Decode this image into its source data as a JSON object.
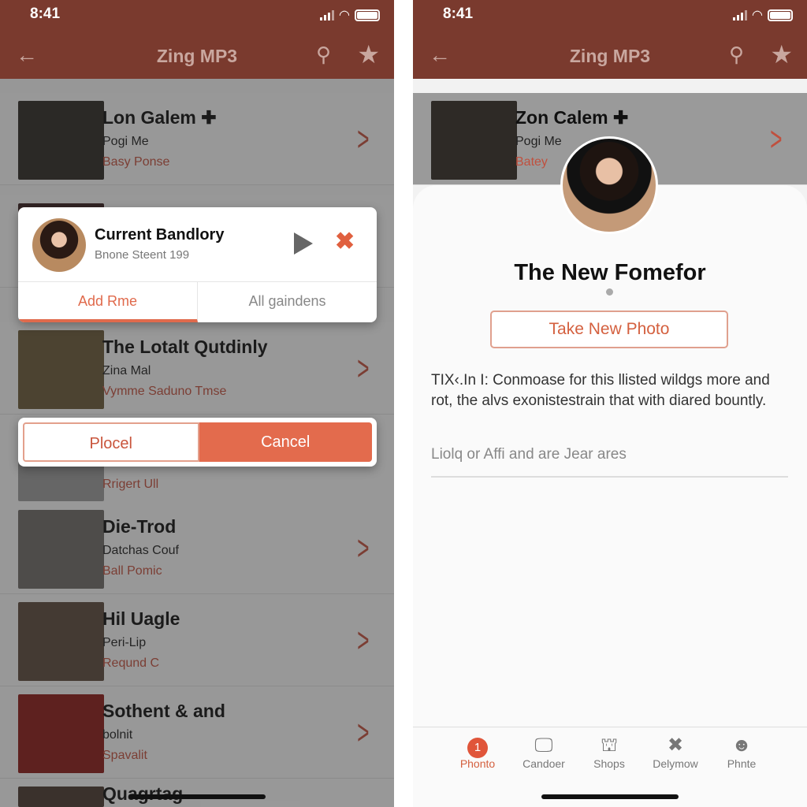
{
  "status": {
    "time": "8:41"
  },
  "app": {
    "title": "Zing MP3"
  },
  "left": {
    "rows": [
      {
        "title": "Lon Galem ✚",
        "subtitle": "Pogi Me",
        "artist": "Basy Ponse",
        "cover": "#2e2a26"
      },
      {
        "title": "",
        "subtitle": "",
        "artist": "",
        "cover": "#3a2020"
      },
      {
        "title": "The Lotalt Qutdinly",
        "subtitle": "Zina Mal",
        "artist": "Vymme Saduno Tmse",
        "cover": "#6a5a3a"
      },
      {
        "title": "",
        "subtitle": "",
        "artist": "Rrigert Ull",
        "cover": "#999"
      },
      {
        "title": "Die-Trod",
        "subtitle": "Datchas Couf",
        "artist": "Ball Pomic",
        "cover": "#6e6a66"
      },
      {
        "title": "Hil Uagle",
        "subtitle": "Peri-Lip",
        "artist": "Reqund C",
        "cover": "#5c4a3c"
      },
      {
        "title": "Sothent & and",
        "subtitle": "bolnit",
        "artist": "Spavalit",
        "cover": "#8a1c18"
      },
      {
        "title": "Quagrtag",
        "subtitle": "",
        "artist": "",
        "cover": "#4a3a30"
      }
    ],
    "modal": {
      "title": "Current Bandlory",
      "subtitle": "Bnone Steent 199",
      "tab_add": "Add Rme",
      "tab_all": "All gaindens"
    },
    "actions": {
      "primary": "Plocel",
      "cancel": "Cancel"
    }
  },
  "right": {
    "row": {
      "title": "Zon Calem ✚",
      "subtitle": "Pogi Me",
      "artist": "Batey",
      "cover": "#2e2a26"
    },
    "sheet": {
      "title": "The New Fomefor",
      "button": "Take New Photo",
      "paragraph": "TIX‹.In I: Conmoase for this llisted wildgs more and rot, the alvs exonistestrain that with diared bountly.",
      "field": "Liolq or Affi and are Jear ares"
    },
    "tabs": [
      {
        "label": "Phonto",
        "icon": "badge-1",
        "badge": "1",
        "active": true
      },
      {
        "label": "Candoer",
        "icon": "monitor-icon"
      },
      {
        "label": "Shops",
        "icon": "bag-icon"
      },
      {
        "label": "Delymow",
        "icon": "bow-icon"
      },
      {
        "label": "Phnte",
        "icon": "smiley-icon"
      }
    ]
  },
  "colors": {
    "header": "#7a3a2e",
    "accent": "#e36b4d"
  }
}
